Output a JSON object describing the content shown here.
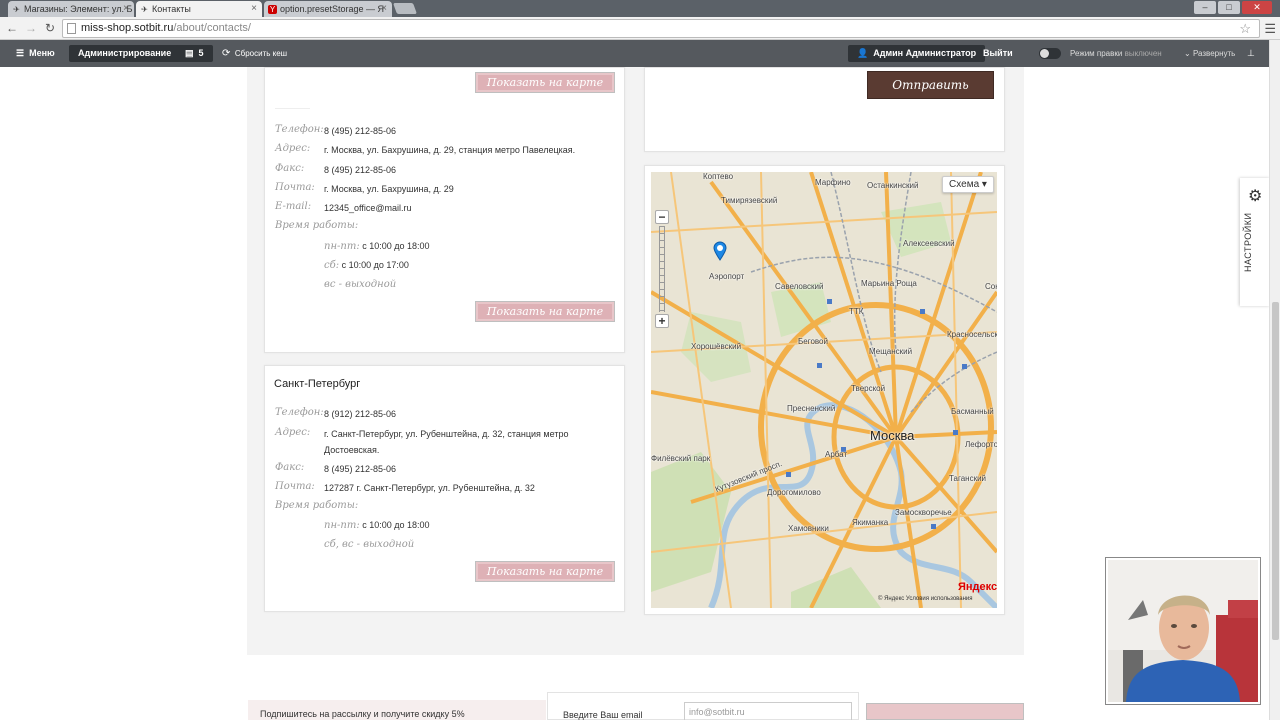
{
  "browser": {
    "tabs": [
      {
        "title": "Магазины: Элемент: ул. Б",
        "icon": "generic-page-icon",
        "active": false
      },
      {
        "title": "Контакты",
        "icon": "generic-page-icon",
        "active": true
      },
      {
        "title": "option.presetStorage — Я",
        "icon": "Y",
        "active": false
      }
    ],
    "url_host": "miss-shop.sotbit.ru",
    "url_path": "/about/contacts/"
  },
  "admin": {
    "menu_label": "Меню",
    "administration_label": "Администрирование",
    "notifications_count": "5",
    "clear_cache_label": "Сбросить кеш",
    "user_label": "Админ Администратор",
    "logout_label": "Выйти",
    "edit_mode_label": "Режим правки",
    "edit_mode_state": "выключен",
    "expand_label": "Развернуть"
  },
  "moscow": {
    "show_map_label": "Показать на карте",
    "phone_label": "Телефон:",
    "phone": "8 (495) 212-85-06",
    "address_label": "Адрес:",
    "address": "г. Москва, ул. Бахрушина, д. 29, станция метро Павелецкая.",
    "fax_label": "Факс:",
    "fax": "8 (495) 212-85-06",
    "mail_label": "Почта:",
    "mail": "г. Москва, ул. Бахрушина, д. 29",
    "email_label": "E-mail:",
    "email": "12345_office@mail.ru",
    "hours_label": "Время работы:",
    "weekdays_label": "пн-пт:",
    "weekdays_hours": "с 10:00 до 18:00",
    "saturday_label": "сб:",
    "saturday_hours": "с 10:00 до 17:00",
    "sunday": "вс - выходной"
  },
  "spb": {
    "city": "Санкт-Петербург",
    "phone_label": "Телефон:",
    "phone": "8 (912) 212-85-06",
    "address_label": "Адрес:",
    "address_line1": "г. Санкт-Петербург, ул. Рубенштейна, д. 32, станция метро",
    "address_line2": "Достоевская.",
    "fax_label": "Факс:",
    "fax": "8 (495) 212-85-06",
    "mail_label": "Почта:",
    "mail": "127287 г. Санкт-Петербург, ул. Рубенштейна, д. 32",
    "hours_label": "Время работы:",
    "weekdays_label": "пн-пт:",
    "weekdays_hours": "с 10:00 до 18:00",
    "weekend": "сб, вс - выходной",
    "show_map_label": "Показать на карте"
  },
  "form": {
    "send_label": "Отправить"
  },
  "map": {
    "scheme_label": "Схема ▾",
    "city_label": "Москва",
    "provider": "Яндекс",
    "copyright": "© Яндекс   Условия использования",
    "labels": [
      "Коптево",
      "Марфино",
      "Останкинский",
      "Тимирязевский",
      "Аэропорт",
      "Савеловский",
      "Алексеевский",
      "Марьина Роща",
      "ТТК",
      "Беговой",
      "Хорошёвский",
      "Мещанский",
      "Тверской",
      "Пресненский",
      "Арбат",
      "Кутузовский просп.",
      "Дорогомилово",
      "Хамовники",
      "Якиманка",
      "Замоскворечье",
      "Таганский",
      "Басманный",
      "Красносельский",
      "Лефортово",
      "Сокольники",
      "Филёвский парк"
    ]
  },
  "settings_tab": {
    "label": "НАСТРОЙКИ"
  },
  "footer": {
    "subscribe_text": "Подпишитесь на рассылку и получите скидку 5%",
    "email_label": "Введите Ваш email",
    "email_placeholder": "info@sotbit.ru"
  }
}
